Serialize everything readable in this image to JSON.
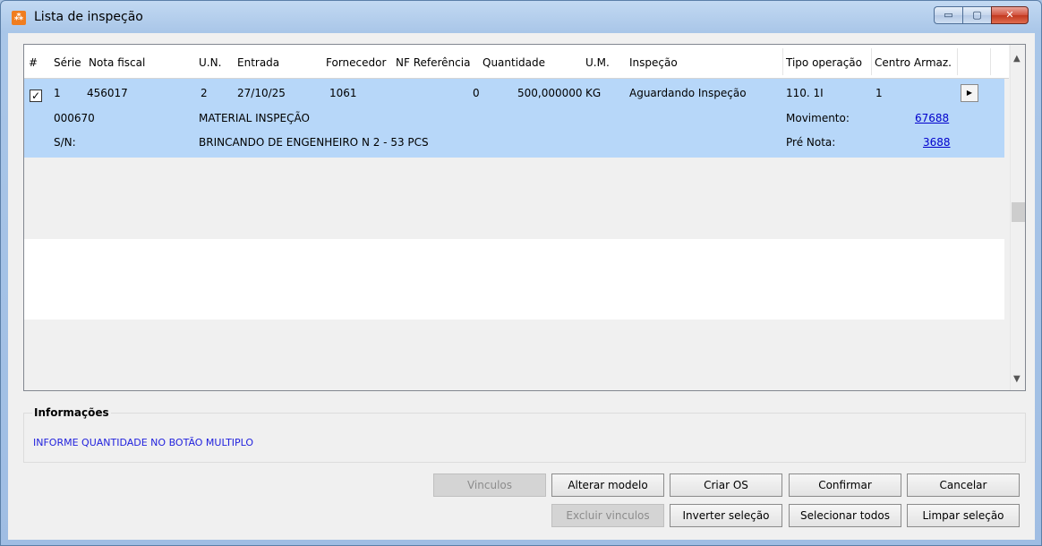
{
  "window": {
    "title": "Lista de inspeção",
    "minimize": "▭",
    "maximize": "▢",
    "close": "✕"
  },
  "grid": {
    "columns": [
      "#",
      "Série",
      "Nota fiscal",
      "U.N.",
      "Entrada",
      "Fornecedor",
      "NF Referência",
      "Quantidade",
      "U.M.",
      "Inspeção",
      "Tipo operação",
      "Centro Armaz."
    ],
    "row": {
      "checked": "✓",
      "serie": "1",
      "nota_fiscal": "456017",
      "un": "2",
      "entrada": "27/10/25",
      "fornecedor": "1061",
      "nf_referencia": "0",
      "quantidade": "500,000000",
      "um": "KG",
      "inspecao": "Aguardando Inspeção",
      "tipo_operacao": "110. 1I",
      "centro_armaz": "1",
      "code": "000670",
      "description": "MATERIAL INSPEÇÃO",
      "movimento_label": "Movimento:",
      "movimento_value": "67688",
      "sn_label": "S/N:",
      "sn_value": "BRINCANDO DE ENGENHEIRO N 2 - 53 PCS",
      "pre_nota_label": "Pré Nota:",
      "pre_nota_value": "3688"
    }
  },
  "info": {
    "title": "Informações",
    "message": "INFORME QUANTIDADE NO BOTÃO MULTIPLO"
  },
  "buttons": {
    "vinculos": "Vinculos",
    "alterar_modelo": "Alterar modelo",
    "criar_os": "Criar OS",
    "confirmar": "Confirmar",
    "cancelar": "Cancelar",
    "excluir_vinculos": "Excluir vinculos",
    "inverter_selecao": "Inverter seleção",
    "selecionar_todos": "Selecionar todos",
    "limpar_selecao": "Limpar seleção"
  }
}
